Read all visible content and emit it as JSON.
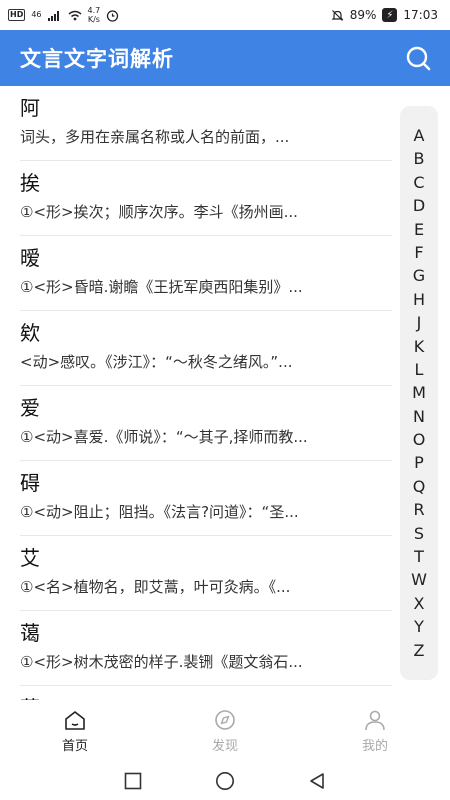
{
  "status_bar": {
    "hd": "HD",
    "network": "46",
    "speed_value": "4.7",
    "speed_unit": "K/s",
    "battery": "89%",
    "time": "17:03"
  },
  "header": {
    "title": "文言文字词解析",
    "search_icon": "search-icon"
  },
  "entries": [
    {
      "word": "阿",
      "definition": "词头，多用在亲属名称或人名的前面，..."
    },
    {
      "word": "挨",
      "definition": "①<形>挨次；顺序次序。李斗《扬州画..."
    },
    {
      "word": "暧",
      "definition": "①<形>昏暗.谢瞻《王抚军庾西阳集别》..."
    },
    {
      "word": "欸",
      "definition": "<动>感叹。《涉江》：“～秋冬之绪风。”..."
    },
    {
      "word": "爱",
      "definition": "①<动>喜爱.《师说》：“～其子,择师而教..."
    },
    {
      "word": "碍",
      "definition": "①<动>阻止；阻挡。《法言?问道》：“圣..."
    },
    {
      "word": "艾",
      "definition": "①<名>植物名，即艾蒿，叶可灸病。《..."
    },
    {
      "word": "蔼",
      "definition": "①<形>树木茂密的样子.裴铏《题文翁石..."
    },
    {
      "word": "蔼",
      "definition": ""
    }
  ],
  "alphabet": [
    "A",
    "B",
    "C",
    "D",
    "E",
    "F",
    "G",
    "H",
    "J",
    "K",
    "L",
    "M",
    "N",
    "O",
    "P",
    "Q",
    "R",
    "S",
    "T",
    "W",
    "X",
    "Y",
    "Z"
  ],
  "bottom_nav": [
    {
      "label": "首页",
      "icon": "home-icon",
      "active": true
    },
    {
      "label": "发现",
      "icon": "compass-icon",
      "active": false
    },
    {
      "label": "我的",
      "icon": "user-icon",
      "active": false
    }
  ],
  "colors": {
    "header_bg": "#3f84e5",
    "alphabet_bg": "#f1f1f1",
    "inactive_nav": "#aaaaaa"
  }
}
